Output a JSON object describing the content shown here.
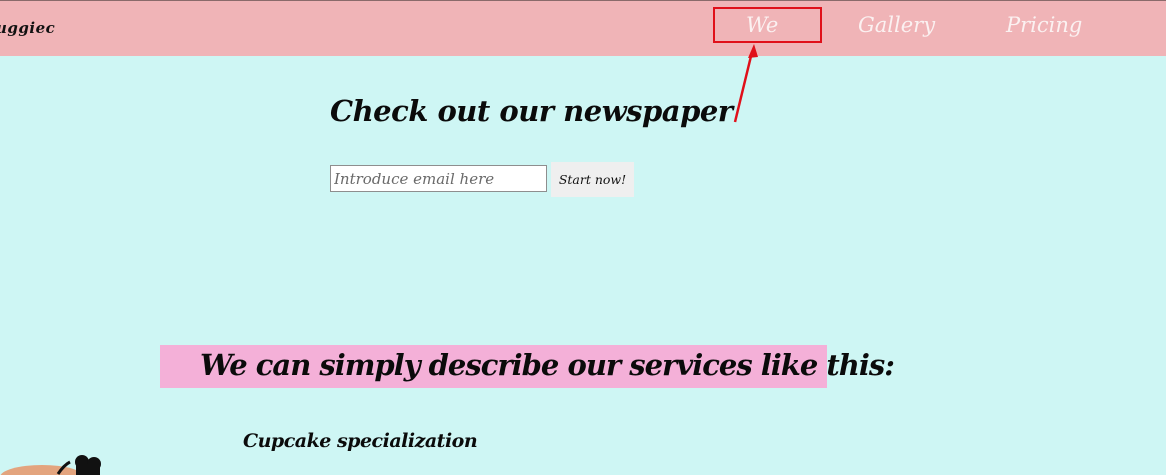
{
  "header": {
    "logo_text": "uggiec",
    "nav": [
      {
        "label": "We"
      },
      {
        "label": "Gallery"
      },
      {
        "label": "Pricing"
      }
    ]
  },
  "newsletter": {
    "title": "Check out our newspaper",
    "email_placeholder": "Introduce email here",
    "button_label": "Start now!"
  },
  "services": {
    "title": "We can simply describe our services like this:",
    "first_item_heading": "Cupcake specialization"
  },
  "colors": {
    "header_bg": "#f0b4b7",
    "page_bg": "#cef6f4",
    "banner_bg": "#f4b0d8",
    "annotation": "#e0101a"
  },
  "icons": {
    "cupcake": "cupcake-illustration",
    "annotation_arrow": "red-arrow"
  }
}
